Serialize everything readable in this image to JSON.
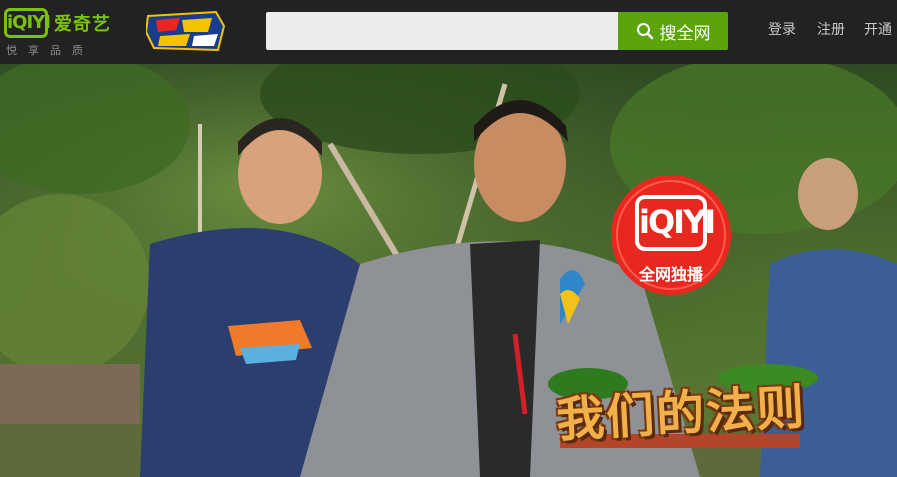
{
  "brand": {
    "logo_mark": "iQIYI",
    "name": "爱奇艺",
    "slogan": "悦享品质",
    "color": "#79c20e"
  },
  "header": {
    "show_logo_icon": "running-man-logo",
    "search": {
      "placeholder": "",
      "value": "",
      "button_label": "搜全网",
      "button_color": "#5ba40b"
    },
    "nav": {
      "login": "登录",
      "register": "注册",
      "vip": "开通​"
    }
  },
  "banner": {
    "badge_mark": "iQIYI",
    "badge_text": "全网独播",
    "badge_color": "#e8281e",
    "title": "我们的法则"
  }
}
